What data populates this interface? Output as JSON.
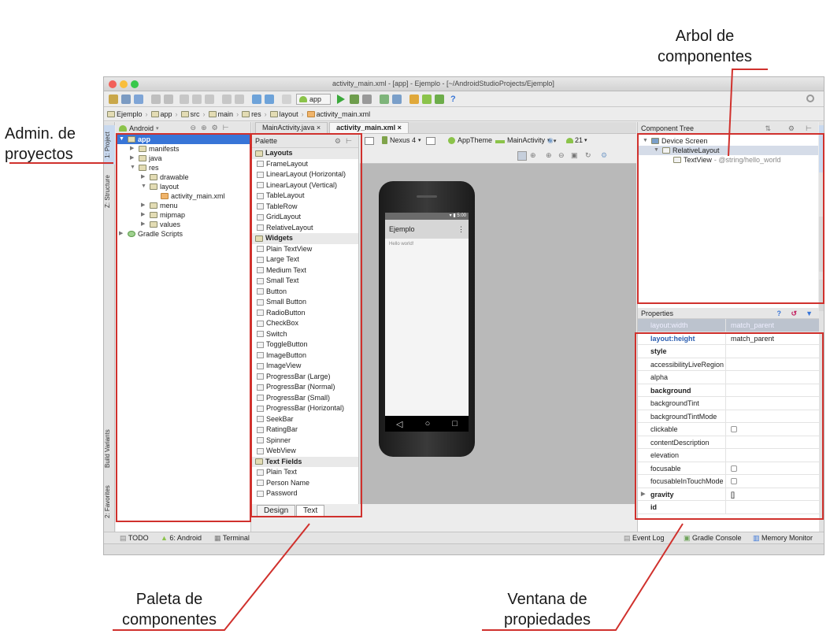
{
  "annotations": {
    "arbol": "Arbol de\ncomponentes",
    "arbol_l1": "Arbol de",
    "arbol_l2": "componentes",
    "admin_l1": "Admin. de",
    "admin_l2": "proyectos",
    "paleta_l1": "Paleta de",
    "paleta_l2": "componentes",
    "ventana_l1": "Ventana de",
    "ventana_l2": "propiedades"
  },
  "window": {
    "title": "activity_main.xml - [app] - Ejemplo - [~/AndroidStudioProjects/Ejemplo]",
    "run_config": "app"
  },
  "breadcrumbs": [
    "Ejemplo",
    "app",
    "src",
    "main",
    "res",
    "layout",
    "activity_main.xml"
  ],
  "project_panel": {
    "view_selector": "Android",
    "tree": [
      {
        "label": "app",
        "indent": 0,
        "expanded": true,
        "selected": true
      },
      {
        "label": "manifests",
        "indent": 1
      },
      {
        "label": "java",
        "indent": 1
      },
      {
        "label": "res",
        "indent": 1,
        "expanded": true
      },
      {
        "label": "drawable",
        "indent": 2
      },
      {
        "label": "layout",
        "indent": 2,
        "expanded": true
      },
      {
        "label": "activity_main.xml",
        "indent": 3
      },
      {
        "label": "menu",
        "indent": 2
      },
      {
        "label": "mipmap",
        "indent": 2
      },
      {
        "label": "values",
        "indent": 2
      },
      {
        "label": "Gradle Scripts",
        "indent": 0
      }
    ]
  },
  "left_tool_tabs": [
    "1: Project",
    "Z: Structure",
    "Build Variants",
    "2: Favorites"
  ],
  "editor_tabs": [
    "MainActivity.java",
    "activity_main.xml"
  ],
  "palette": {
    "title": "Palette",
    "sections": [
      {
        "name": "Layouts",
        "items": [
          "FrameLayout",
          "LinearLayout (Horizontal)",
          "LinearLayout (Vertical)",
          "TableLayout",
          "TableRow",
          "GridLayout",
          "RelativeLayout"
        ]
      },
      {
        "name": "Widgets",
        "items": [
          "Plain TextView",
          "Large Text",
          "Medium Text",
          "Small Text",
          "Button",
          "Small Button",
          "RadioButton",
          "CheckBox",
          "Switch",
          "ToggleButton",
          "ImageButton",
          "ImageView",
          "ProgressBar (Large)",
          "ProgressBar (Normal)",
          "ProgressBar (Small)",
          "ProgressBar (Horizontal)",
          "SeekBar",
          "RatingBar",
          "Spinner",
          "WebView"
        ]
      },
      {
        "name": "Text Fields",
        "items": [
          "Plain Text",
          "Person Name",
          "Password"
        ]
      }
    ]
  },
  "design_toolbar": {
    "device": "Nexus 4",
    "theme": "AppTheme",
    "activity": "MainActivity",
    "api": "21"
  },
  "device_preview": {
    "clock": "5:00",
    "app_title": "Ejemplo",
    "hello_text": "Hello world!"
  },
  "bottom_editor_tabs": [
    "Design",
    "Text"
  ],
  "component_tree": {
    "title": "Component Tree",
    "rows": [
      {
        "label": "Device Screen",
        "indent": 0
      },
      {
        "label": "RelativeLayout",
        "indent": 1,
        "selected": true
      },
      {
        "label": "TextView",
        "suffix": "- @string/hello_world",
        "indent": 2
      }
    ]
  },
  "properties": {
    "title": "Properties",
    "header_row": {
      "k": "layout:width",
      "v": "match_parent"
    },
    "rows": [
      {
        "k": "layout:height",
        "v": "match_parent",
        "blue": true
      },
      {
        "k": "style",
        "v": "",
        "bold": true
      },
      {
        "k": "accessibilityLiveRegion",
        "v": ""
      },
      {
        "k": "alpha",
        "v": ""
      },
      {
        "k": "background",
        "v": "",
        "bold": true
      },
      {
        "k": "backgroundTint",
        "v": ""
      },
      {
        "k": "backgroundTintMode",
        "v": ""
      },
      {
        "k": "clickable",
        "v": "",
        "checkbox": true
      },
      {
        "k": "contentDescription",
        "v": ""
      },
      {
        "k": "elevation",
        "v": ""
      },
      {
        "k": "focusable",
        "v": "",
        "checkbox": true
      },
      {
        "k": "focusableInTouchMode",
        "v": "",
        "checkbox": true
      },
      {
        "k": "gravity",
        "v": "[]",
        "bold": true,
        "expandable": true
      },
      {
        "k": "id",
        "v": "",
        "bold": true
      }
    ]
  },
  "status_bar": {
    "left": [
      "TODO",
      "6: Android",
      "Terminal"
    ],
    "right": [
      "Event Log",
      "Gradle Console",
      "Memory Monitor"
    ]
  },
  "colors": {
    "annotation_red": "#d0312d",
    "selection_blue": "#3875d7",
    "android_green": "#8bc34a"
  }
}
